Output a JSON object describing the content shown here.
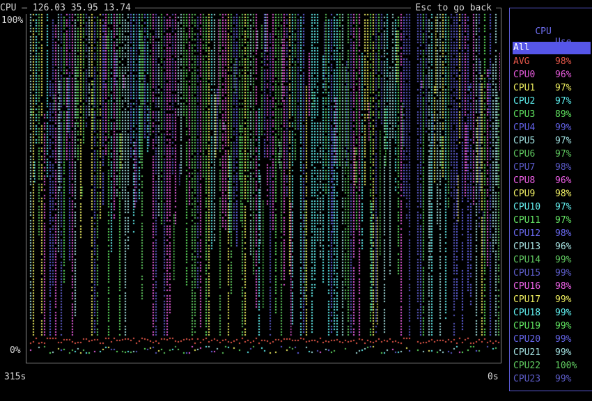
{
  "header": {
    "title": "CPU — 126.03 35.95 13.74",
    "hint": "Esc to go back"
  },
  "axis": {
    "y_top": "100%",
    "y_bottom": "0%",
    "x_left": "315s",
    "x_right": "0s"
  },
  "legend": {
    "col_cpu": "CPU",
    "col_use": "Use",
    "selected": "All",
    "accent": "#5656e8",
    "rows": [
      {
        "name": "AVG",
        "use": "98%",
        "color": "#e8584a"
      },
      {
        "name": "CPU0",
        "use": "96%",
        "color": "#e85cde"
      },
      {
        "name": "CPU1",
        "use": "97%",
        "color": "#f0f060"
      },
      {
        "name": "CPU2",
        "use": "97%",
        "color": "#5ef0f0"
      },
      {
        "name": "CPU3",
        "use": "89%",
        "color": "#5ee05e"
      },
      {
        "name": "CPU4",
        "use": "99%",
        "color": "#6262e8"
      },
      {
        "name": "CPU5",
        "use": "97%",
        "color": "#9fe0e0"
      },
      {
        "name": "CPU6",
        "use": "97%",
        "color": "#5fc85f"
      },
      {
        "name": "CPU7",
        "use": "98%",
        "color": "#5a5ac8"
      },
      {
        "name": "CPU8",
        "use": "96%",
        "color": "#f060e8"
      },
      {
        "name": "CPU9",
        "use": "98%",
        "color": "#f4f466"
      },
      {
        "name": "CPU10",
        "use": "97%",
        "color": "#66f4f4"
      },
      {
        "name": "CPU11",
        "use": "97%",
        "color": "#66e866"
      },
      {
        "name": "CPU12",
        "use": "98%",
        "color": "#6a6af0"
      },
      {
        "name": "CPU13",
        "use": "96%",
        "color": "#a8e4e4"
      },
      {
        "name": "CPU14",
        "use": "99%",
        "color": "#62cc62"
      },
      {
        "name": "CPU15",
        "use": "99%",
        "color": "#5e5ecc"
      },
      {
        "name": "CPU16",
        "use": "98%",
        "color": "#f064ea"
      },
      {
        "name": "CPU17",
        "use": "99%",
        "color": "#f4f462"
      },
      {
        "name": "CPU18",
        "use": "99%",
        "color": "#62f4f4"
      },
      {
        "name": "CPU19",
        "use": "99%",
        "color": "#62e862"
      },
      {
        "name": "CPU20",
        "use": "99%",
        "color": "#6666ec"
      },
      {
        "name": "CPU21",
        "use": "99%",
        "color": "#a4e2e2"
      },
      {
        "name": "CPU22",
        "use": "100%",
        "color": "#60cc60"
      },
      {
        "name": "CPU23",
        "use": "99%",
        "color": "#5c5cc8"
      }
    ]
  }
}
